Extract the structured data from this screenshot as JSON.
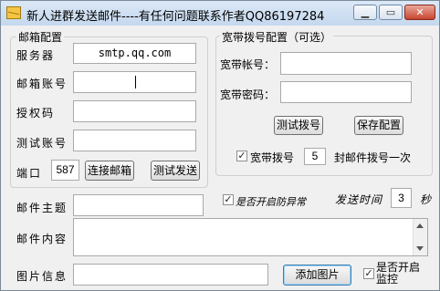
{
  "window": {
    "title": "新人进群发送邮件----有任何问题联系作者QQ86197284"
  },
  "mail_group": {
    "title": "邮箱配置",
    "server_label": "服务器",
    "server_value": "smtp.qq.com",
    "account_label": "邮箱账号",
    "auth_label": "授权码",
    "test_account_label": "测试账号",
    "port_label": "端口",
    "port_value": "587",
    "connect_button": "连接邮箱",
    "test_send_button": "测试发送"
  },
  "dial_group": {
    "title": "宽带拨号配置（可选）",
    "account_label": "宽带帐号：",
    "password_label": "宽带密码：",
    "test_dial_button": "测试拨号",
    "save_button": "保存配置",
    "dial_checkbox_label": "宽带拨号",
    "dial_count": "5",
    "dial_suffix": "封邮件拨号一次"
  },
  "send": {
    "subject_label": "邮件主题",
    "anti_abnormal_label": "是否开启防异常",
    "interval_label": "发送时间",
    "interval_value": "3",
    "interval_unit": "秒",
    "content_label": "邮件内容",
    "image_label": "图片信息",
    "add_image_button": "添加图片",
    "monitor_label": "是否开启监控"
  }
}
